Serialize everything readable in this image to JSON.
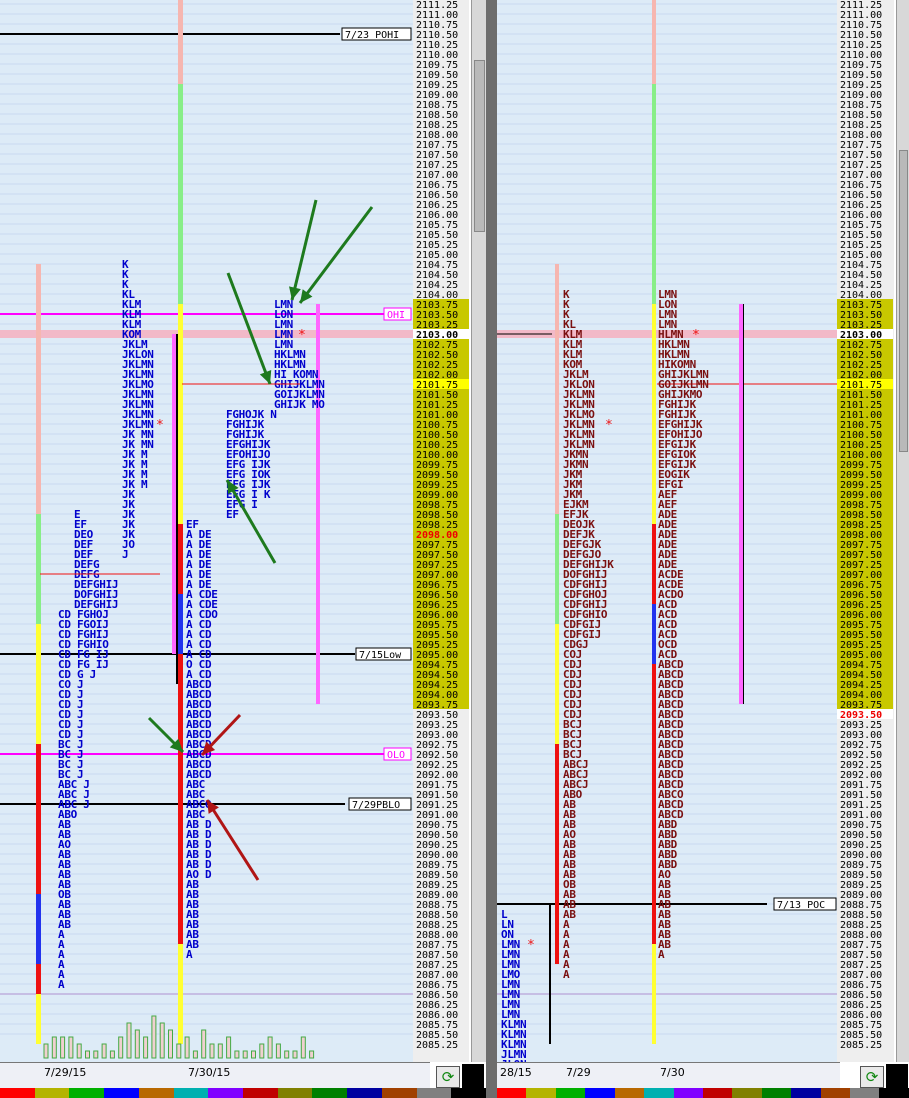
{
  "chart_data": [
    {
      "type": "market-profile",
      "panel": "left",
      "ylim": [
        2085.25,
        2111.25
      ],
      "sessions": [
        {
          "label": "7/29/15",
          "open": 2090.75,
          "close": 2094.25,
          "high": 2106.25,
          "low": 2085.25
        },
        {
          "label": "7/30/15",
          "open": 2100.5,
          "close": 2103.5,
          "high": 2111.25,
          "low": 2085.25
        }
      ],
      "reference_lines": [
        {
          "label": "7/23 POHI",
          "price": 2110.5
        },
        {
          "label": "OHI",
          "price": 2103.5
        },
        {
          "label": "7/15Low",
          "price": 2095.0
        },
        {
          "label": "OLO",
          "price": 2092.5
        },
        {
          "label": "7/29PBLO",
          "price": 2091.25
        }
      ],
      "highlighted_prices": [
        2103.0,
        2101.75,
        2098.0
      ],
      "profile_rows": [
        {
          "price": 2103.75,
          "left": "K",
          "mid": "LMN"
        },
        {
          "price": 2103.5,
          "left": "K",
          "mid": "LON"
        },
        {
          "price": 2103.25,
          "left": "K",
          "mid": "LMN"
        },
        {
          "price": 2103.0,
          "left": "KL",
          "mid": "LMN"
        },
        {
          "price": 2102.75,
          "left": "KLM",
          "mid": "LMN"
        },
        {
          "price": 2102.5,
          "left": "KLM",
          "mid": "HKLMN"
        },
        {
          "price": 2102.25,
          "left": "KLM",
          "mid": "HKLMN"
        },
        {
          "price": 2102.0,
          "left": "KOM",
          "mid": "HKLMN"
        },
        {
          "price": 2101.75,
          "left": "JKLM",
          "mid": "HI KOMN"
        },
        {
          "price": 2101.5,
          "left": "JKLON",
          "mid": "GHIJKLMN"
        },
        {
          "price": 2101.25,
          "left": "JKLMN",
          "mid": "GOIJKLMN"
        },
        {
          "price": 2101.0,
          "left": "JKLMN",
          "mid": "GHIJKLMO"
        },
        {
          "price": 2100.75,
          "left": "JKLMO",
          "mid": "GHIJK N"
        },
        {
          "price": 2100.5,
          "left": "JKLMN",
          "mid": "FGHOJK"
        },
        {
          "price": 2100.25,
          "left": "JKLMN",
          "mid": "FGHIJK"
        },
        {
          "price": 2100.0,
          "left": "JKLMN",
          "mid": "FGHIJK"
        },
        {
          "price": 2099.75,
          "left": "JKLMN",
          "mid": "EFGHIJK"
        },
        {
          "price": 2099.5,
          "left": "JK MN",
          "mid": "EFOHIJO"
        },
        {
          "price": 2099.25,
          "left": "JK MN",
          "mid": "EFG IJK"
        },
        {
          "price": 2099.0,
          "left": "JK M",
          "mid": "EFG IOK"
        },
        {
          "price": 2098.75,
          "left": "JK M",
          "mid": "EFG IJK"
        },
        {
          "price": 2098.5,
          "left": "JK M",
          "mid": "EFG I K"
        },
        {
          "price": 2098.25,
          "left": "JK M",
          "mid": "EFG I"
        },
        {
          "price": 2098.0,
          "left": "E JK",
          "mid": "EF"
        }
      ],
      "volume_bars": [
        2,
        3,
        3,
        3,
        2,
        1,
        1,
        2,
        1,
        3,
        5,
        4,
        3,
        6,
        5,
        4,
        2,
        3,
        1,
        4,
        2,
        2,
        3,
        1,
        1,
        1,
        2,
        3,
        2,
        1,
        1,
        3,
        1
      ]
    },
    {
      "type": "market-profile",
      "panel": "right",
      "ylim": [
        2085.25,
        2111.25
      ],
      "sessions": [
        {
          "label": "28/15",
          "open": 2087.5,
          "close": 2086.0,
          "high": 2088.75,
          "low": 2085.25
        },
        {
          "label": "7/29",
          "open": 2086.75,
          "close": 2094.0,
          "high": 2104.0,
          "low": 2086.75
        },
        {
          "label": "7/30",
          "open": 2093.75,
          "close": 2103.75,
          "high": 2111.25,
          "low": 2085.25
        }
      ],
      "reference_lines": [
        {
          "label": "7/13 POC",
          "price": 2088.75
        }
      ],
      "highlighted_prices": [
        2103.0,
        2101.75,
        2093.5
      ],
      "profile_rows": [
        {
          "price": 2104.0,
          "a": "K",
          "b": "LMN"
        },
        {
          "price": 2103.75,
          "a": "K",
          "b": "LON"
        },
        {
          "price": 2103.5,
          "a": "K",
          "b": "LMN"
        },
        {
          "price": 2103.25,
          "a": "KL",
          "b": "LMN"
        },
        {
          "price": 2103.0,
          "a": "KLM",
          "b": "HLMN"
        },
        {
          "price": 2102.75,
          "a": "KLM",
          "b": "HKLMN"
        },
        {
          "price": 2102.5,
          "a": "KLM",
          "b": "HKLMN"
        },
        {
          "price": 2102.25,
          "a": "KOM",
          "b": "HIKOMN"
        },
        {
          "price": 2102.0,
          "a": "JKLM",
          "b": "GHIJKLMN"
        },
        {
          "price": 2101.75,
          "a": "JKLON",
          "b": "GOIJKLMN"
        },
        {
          "price": 2101.5,
          "a": "JKLMN",
          "b": "GHIJKMO"
        },
        {
          "price": 2101.25,
          "a": "JKLMN",
          "b": "FGHIJK"
        },
        {
          "price": 2101.0,
          "a": "JKLMO",
          "b": "FGHIJK"
        },
        {
          "price": 2100.75,
          "a": "JKLMN",
          "b": "EFGHIJK"
        },
        {
          "price": 2100.5,
          "a": "JKLMN",
          "b": "EFOHIJO"
        },
        {
          "price": 2100.25,
          "a": "JKLMN",
          "b": "EFGIJK"
        },
        {
          "price": 2100.0,
          "a": "JKMN",
          "b": "EFGIOK"
        },
        {
          "price": 2099.75,
          "a": "JKMN",
          "b": "EFGIJK"
        },
        {
          "price": 2099.5,
          "a": "JKM",
          "b": "EOGIK"
        },
        {
          "price": 2099.25,
          "a": "JKM",
          "b": "EFGI"
        },
        {
          "price": 2099.0,
          "a": "JKM",
          "b": "AEF"
        },
        {
          "price": 2098.75,
          "a": "EJKM",
          "b": "AEF"
        },
        {
          "price": 2098.5,
          "a": "EFJK",
          "b": "ADE"
        },
        {
          "price": 2098.25,
          "a": "DEOJK",
          "b": "ADE"
        },
        {
          "price": 2098.0,
          "a": "DEFJK",
          "b": "ADE"
        }
      ],
      "volume_bars": []
    }
  ],
  "left": {
    "line_labels": [
      "7/23 POHI",
      "OHI",
      "7/15Low",
      "OLO",
      "7/29PBLO"
    ],
    "profile": {
      "s1": [
        "E",
        "EF",
        "DEO",
        "DEF",
        "DEF",
        "DEFG",
        "DEFG",
        "DEFGHIJ",
        "DOFGHIJ",
        "DEFGHIJ",
        "CD  FGHOJ",
        "CD  FGOIJ",
        "CD  FGHIJ",
        "CD  FGHIO",
        "CD  FG IJ",
        "CD  FG IJ",
        "CD    G  J",
        "CO        J",
        "CD        J",
        "CD        J",
        "CD        J",
        "CD        J",
        "CD        J",
        "BC        J",
        "BC        J",
        "BC        J",
        "BC        J",
        "ABC       J",
        "ABC       J",
        "ABC       J",
        "ABO",
        "AB",
        "AB",
        "AO",
        "AB",
        "AB",
        "AB",
        "AB",
        "OB",
        "AB",
        "AB",
        "AB",
        "A",
        "A",
        "A",
        "A",
        "A",
        "A"
      ],
      "s1top": [
        "K",
        "K",
        "K",
        "KL",
        "KLM",
        "KLM",
        "KLM",
        "KOM",
        "JKLM",
        "JKLON",
        "JKLMN",
        "JKLMN",
        "JKLMO",
        "JKLMN",
        "JKLMN",
        "JKLMN",
        "JKLMN",
        "JK MN",
        "JK MN",
        "JK M",
        "JK M",
        "JK M",
        "JK M",
        "JK",
        "JK",
        "JK",
        "JK",
        "JK",
        "JO",
        "J"
      ],
      "s2": [
        "LMN",
        "LON",
        "LMN",
        "LMN",
        "LMN",
        "HKLMN",
        "HKLMN",
        "HI KOMN",
        "GHIJKLMN",
        "GOIJKLMN",
        "GHIJK MO",
        "FGHOJK  N",
        "FGHIJK",
        "FGHIJK",
        "EFGHIJK",
        "EFOHIJO",
        "EFG IJK",
        "EFG IOK",
        "EFG IJK",
        "EFG I K",
        "EFG I",
        "EF",
        "EF",
        "A  DE",
        "A  DE",
        "A  DE",
        "A  DE",
        "A  DE",
        "A  DE",
        "A  CDE",
        "A  CDE",
        "A  CDO",
        "A  CD",
        "A  CD",
        "A  CD",
        "A  CD",
        "O  CD",
        "A  CD",
        "ABCD",
        "ABCD",
        "ABCD",
        "ABCD",
        "ABCD",
        "ABCD",
        "ABCD",
        "ABCD",
        "ABCD",
        "ABCD",
        "ABC",
        "ABC",
        "ABCO",
        "ABC",
        "AB  D",
        "AB  D",
        "AB  D",
        "AB  D",
        "AB  D",
        "AO  D",
        "AB",
        "AB",
        "AB",
        "AB",
        "AB",
        "AB",
        "AB",
        "A"
      ]
    },
    "dates": [
      "7/29/15",
      "7/30/15"
    ]
  },
  "right": {
    "line_labels": [
      "7/13 POC"
    ],
    "profile": {
      "s0": [
        "L",
        "LN",
        "ON",
        "LMN",
        "LMN",
        "LMN",
        "LMO",
        "LMN",
        "LMN",
        "LMN",
        "LMN",
        "KLMN",
        "KLMN",
        "KLMN",
        "JLMN",
        "JLON"
      ],
      "s1": [
        "K",
        "K",
        "K",
        "KL",
        "KLM",
        "KLM",
        "KLM",
        "KOM",
        "JKLM",
        "JKLON",
        "JKLMN",
        "JKLMN",
        "JKLMO",
        "JKLMN",
        "JKLMN",
        "JKLMN",
        "JKMN",
        "JKMN",
        "JKM",
        "JKM",
        "JKM",
        "EJKM",
        "EFJK",
        "DEOJK",
        "DEFJK",
        "DEFGJK",
        "DEFGJO",
        "DEFGHIJK",
        "DOFGHIJ",
        "CDFGHIJ",
        "CDFGHOJ",
        "CDFGHIJ",
        "CDFGHIO",
        "CDFGIJ",
        "CDFGIJ",
        "CDGJ",
        "COJ",
        "CDJ",
        "CDJ",
        "CDJ",
        "CDJ",
        "CDJ",
        "CDJ",
        "BCJ",
        "BCJ",
        "BCJ",
        "BCJ",
        "ABCJ",
        "ABCJ",
        "ABCJ",
        "ABO",
        "AB",
        "AB",
        "AB",
        "AO",
        "AB",
        "AB",
        "AB",
        "AB",
        "OB",
        "AB",
        "AB",
        "AB",
        "A",
        "A",
        "A",
        "A",
        "A",
        "A"
      ],
      "s2": [
        "LMN",
        "LON",
        "LMN",
        "LMN",
        "HLMN",
        "HKLMN",
        "HKLMN",
        "HIKOMN",
        "GHIJKLMN",
        "GOIJKLMN",
        "GHIJKMO",
        "FGHIJK",
        "FGHIJK",
        "EFGHIJK",
        "EFOHIJO",
        "EFGIJK",
        "EFGIOK",
        "EFGIJK",
        "EOGIK",
        "EFGI",
        "AEF",
        "AEF",
        "ADE",
        "ADE",
        "ADE",
        "ADE",
        "ADE",
        "ADE",
        "ACDE",
        "ACDE",
        "ACDO",
        "ACD",
        "ACD",
        "ACD",
        "ACD",
        "OCD",
        "ACD",
        "ABCD",
        "ABCD",
        "ABCD",
        "ABCD",
        "ABCD",
        "ABCD",
        "ABCD",
        "ABCD",
        "ABCD",
        "ABCD",
        "ABCD",
        "ABCD",
        "ABCD",
        "ABCO",
        "ABCD",
        "ABCD",
        "ABD",
        "ABD",
        "ABD",
        "ABD",
        "ABD",
        "AO",
        "AB",
        "AB",
        "AB",
        "AB",
        "AB",
        "AB",
        "AB",
        "A"
      ]
    },
    "dates": [
      "28/15",
      "7/29",
      "7/30"
    ]
  },
  "colors": {
    "background": "#ddebf7",
    "profile_letters": "#0000cc",
    "profile_letters_right": "#7a1010",
    "magenta_line": "#ff00ff",
    "black_line": "#000000",
    "arrow_green": "#1e7a1e",
    "arrow_red": "#b01515",
    "highlight_olive": "#c8c800",
    "highlight_yellow": "#ffff00",
    "poc_red": "#ee0000"
  },
  "swatch_colors": [
    "#ff0000",
    "#b4b400",
    "#00b000",
    "#0000ff",
    "#b86800",
    "#00b0b0",
    "#8000ff",
    "#c00000",
    "#808000",
    "#008000",
    "#0000a0",
    "#a04000",
    "#808080",
    "#000000"
  ]
}
